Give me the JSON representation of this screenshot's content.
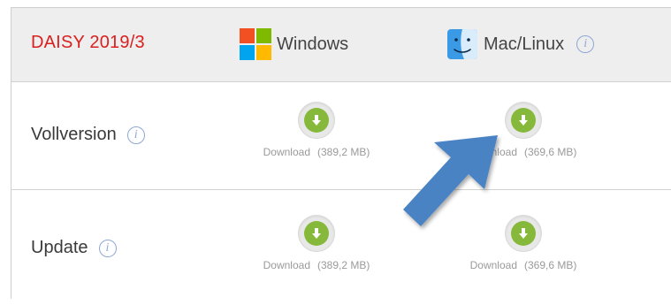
{
  "header": {
    "product": "DAISY 2019/3",
    "windows_label": "Windows",
    "mac_label": "Mac/Linux",
    "info_glyph": "i"
  },
  "rows": [
    {
      "label": "Vollversion",
      "windows": {
        "link": "Download",
        "size": "(389,2 MB)"
      },
      "mac": {
        "link": "Download",
        "size": "(369,6 MB)"
      }
    },
    {
      "label": "Update",
      "windows": {
        "link": "Download",
        "size": "(389,2 MB)"
      },
      "mac": {
        "link": "Download",
        "size": "(369,6 MB)"
      }
    }
  ],
  "icons": {
    "windows": "windows-logo-icon",
    "mac": "finder-icon",
    "info": "info-circle-icon",
    "download": "download-arrow-icon",
    "annotation": "blue-pointer-arrow"
  },
  "colors": {
    "product_title": "#d9201f",
    "header_bg": "#eeeeee",
    "download_green": "#86b83b",
    "info_blue": "#8fa7d4",
    "annotation_arrow": "#4a83c4",
    "win_red": "#f25022",
    "win_green": "#7fba00",
    "win_blue": "#00a4ef",
    "win_yellow": "#ffb900"
  }
}
